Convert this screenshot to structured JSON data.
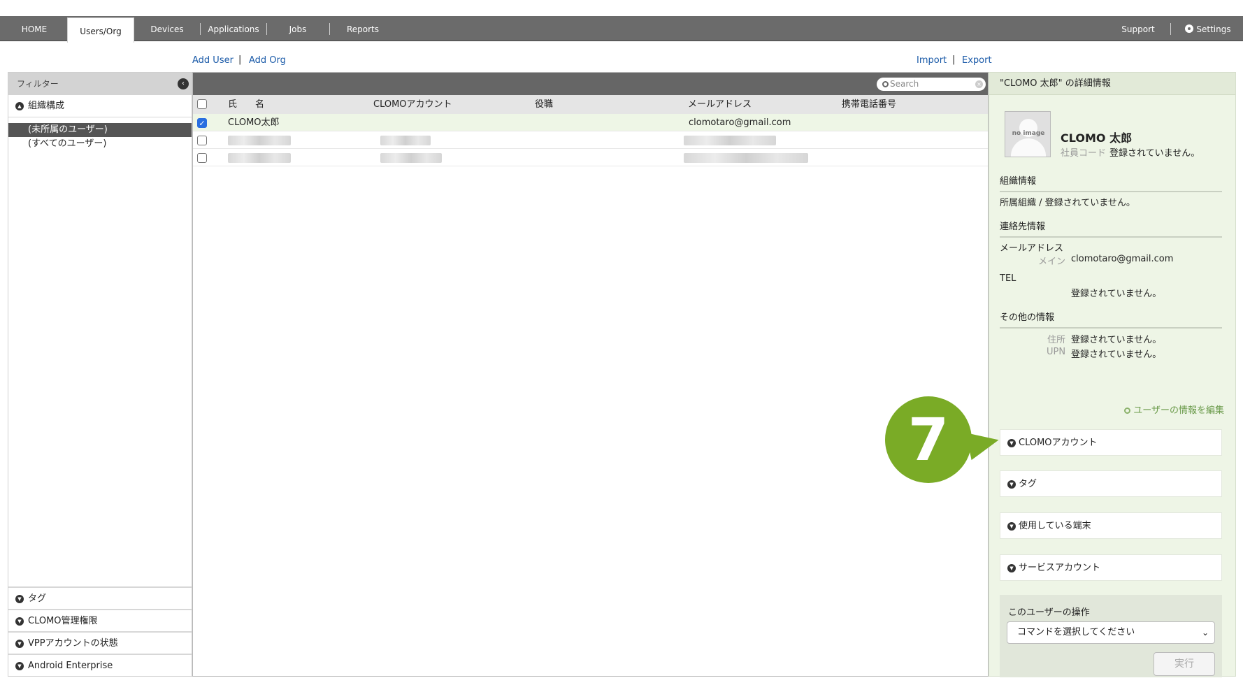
{
  "nav": {
    "tabs": [
      "HOME",
      "Users/Org",
      "Devices",
      "Applications",
      "Jobs",
      "Reports"
    ],
    "support": "Support",
    "settings": "Settings"
  },
  "actions": {
    "add_user": "Add User",
    "add_org": "Add Org",
    "import": "Import",
    "export": "Export",
    "sep": "|"
  },
  "filter": {
    "title": "フィルター",
    "org_section": "組織構成",
    "tree": [
      "(未所属のユーザー)",
      "(すべてのユーザー)"
    ],
    "bottom_sections": [
      "タグ",
      "CLOMO管理権限",
      "VPPアカウントの状態",
      "Android Enterprise"
    ]
  },
  "table": {
    "search_placeholder": "Search",
    "headers": [
      "氏　　名",
      "CLOMOアカウント",
      "役職",
      "メールアドレス",
      "携帯電話番号"
    ],
    "rows": [
      {
        "name": "CLOMO太郎",
        "email": "clomotaro@gmail.com",
        "checked": true
      }
    ]
  },
  "detail": {
    "title": "\"CLOMO 太郎\" の詳細情報",
    "avatar_text": "no image",
    "user_name": "CLOMO 太郎",
    "employee_code_label": "社員コード",
    "not_registered": "登録されていません。",
    "org_info": "組織情報",
    "org_line": "所属組織 / 登録されていません。",
    "contact_info": "連絡先情報",
    "mail_label": "メールアドレス",
    "main_label": "メイン",
    "main_email": "clomotaro@gmail.com",
    "tel_label": "TEL",
    "other_info": "その他の情報",
    "address_label": "住所",
    "upn_label": "UPN",
    "edit_link": "ユーザーの情報を編集",
    "accordions": [
      "CLOMOアカウント",
      "タグ",
      "使用している端末",
      "サービスアカウント"
    ],
    "ops_title": "このユーザーの操作",
    "command_placeholder": "コマンドを選択してください",
    "run_button": "実行"
  },
  "callout": {
    "number": "7",
    "color": "#7aab26"
  }
}
